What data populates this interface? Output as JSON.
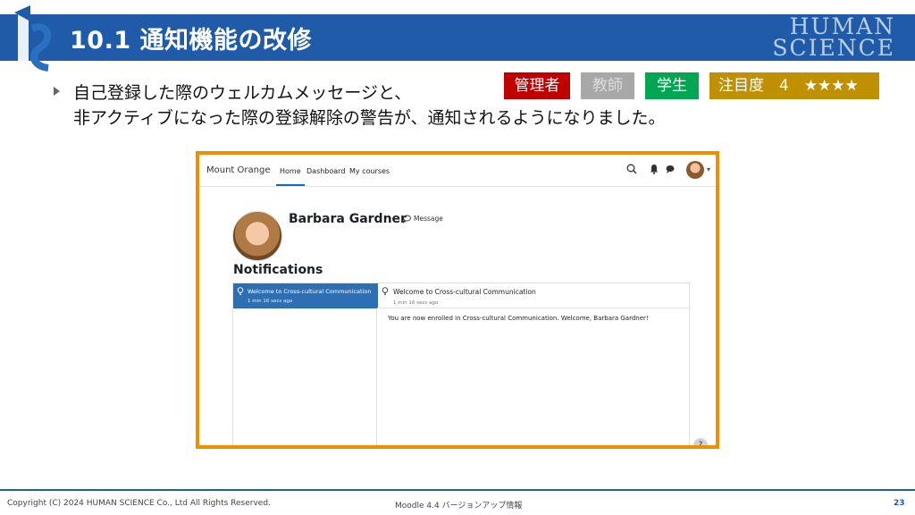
{
  "slide": {
    "title": "10.1 通知機能の改修",
    "brand_line1": "HUMAN",
    "brand_line2": "SCIENCE",
    "bullet_line1": "自己登録した際のウェルカムメッセージと、",
    "bullet_line2": "非アクティブになった際の登録解除の警告が、通知されるようになりました。"
  },
  "tags": {
    "admin": "管理者",
    "teacher": "教師",
    "student": "学生",
    "attention": "注目度　4　★★★★"
  },
  "colors": {
    "header": "#1f5ba8",
    "frame": "#ef8f00",
    "admin": "#c00000",
    "teacher": "#a8a8a8",
    "student": "#00a651",
    "attention": "#bf9000",
    "selected_notification": "#2e6fb3"
  },
  "moodle": {
    "site_name": "Mount Orange",
    "nav": {
      "home": "Home",
      "dashboard": "Dashboard",
      "my_courses": "My courses"
    },
    "icons": [
      "search-icon",
      "bell-icon",
      "chat-icon",
      "user-avatar",
      "chevron-down-icon"
    ],
    "profile": {
      "name": "Barbara Gardner",
      "message_label": "Message"
    },
    "notifications_heading": "Notifications",
    "list_item": {
      "title": "Welcome to Cross-cultural Communication",
      "time": "1 min 16 secs ago"
    },
    "detail": {
      "title": "Welcome to Cross-cultural Communication",
      "time": "1 min 16 secs ago",
      "body": "You are now enrolled in Cross-cultural Communication. Welcome, Barbara Gardner!"
    },
    "help_label": "?"
  },
  "footer": {
    "copyright": "Copyright (C) 2024 HUMAN SCIENCE Co., Ltd All Rights Reserved.",
    "center": "Moodle 4.4 バージョンアップ情報",
    "page": "23"
  }
}
